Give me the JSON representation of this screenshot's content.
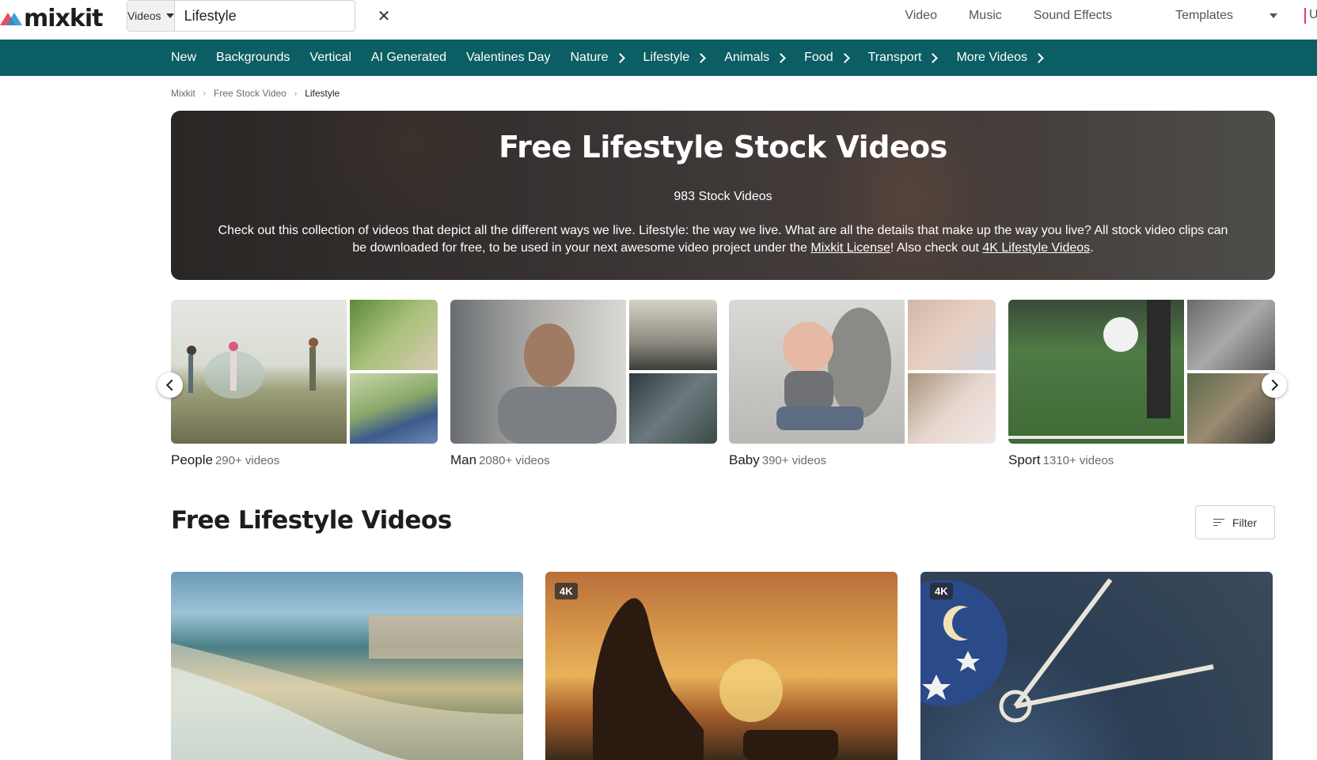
{
  "header": {
    "logo": "mixkit",
    "search": {
      "type": "Videos",
      "value": "Lifestyle"
    },
    "nav": [
      "Video",
      "Music",
      "Sound Effects",
      "Templates"
    ],
    "nav_cut": "U"
  },
  "categories": [
    {
      "label": "New",
      "chevron": false
    },
    {
      "label": "Backgrounds",
      "chevron": false
    },
    {
      "label": "Vertical",
      "chevron": false
    },
    {
      "label": "AI Generated",
      "chevron": false
    },
    {
      "label": "Valentines Day",
      "chevron": false
    },
    {
      "label": "Nature",
      "chevron": true
    },
    {
      "label": "Lifestyle",
      "chevron": true
    },
    {
      "label": "Animals",
      "chevron": true
    },
    {
      "label": "Food",
      "chevron": true
    },
    {
      "label": "Transport",
      "chevron": true
    },
    {
      "label": "More Videos",
      "chevron": true
    }
  ],
  "breadcrumb": [
    "Mixkit",
    "Free Stock Video",
    "Lifestyle"
  ],
  "hero": {
    "title": "Free Lifestyle Stock Videos",
    "count": "983 Stock Videos",
    "desc_before": "Check out this collection of videos that depict all the different ways we live. Lifestyle: the way we live. What are all the details that make up the way you live? All stock video clips can be downloaded for free, to be used in your next awesome video project under the ",
    "license_link": "Mixkit License",
    "desc_middle": "! Also check out ",
    "four_k_link": "4K Lifestyle Videos",
    "desc_after": "."
  },
  "collections": [
    {
      "name": "People",
      "count": "290+ videos"
    },
    {
      "name": "Man",
      "count": "2080+ videos"
    },
    {
      "name": "Baby",
      "count": "390+ videos"
    },
    {
      "name": "Sport",
      "count": "1310+ videos"
    }
  ],
  "section": {
    "title": "Free Lifestyle Videos",
    "filter_label": "Filter"
  },
  "videos": [
    {
      "badge": ""
    },
    {
      "badge": "4K"
    },
    {
      "badge": "4K"
    }
  ],
  "colors": {
    "category_bar": "#0b5e63",
    "logo_red": "#ef4b5c",
    "logo_blue": "#1f8fcf"
  }
}
